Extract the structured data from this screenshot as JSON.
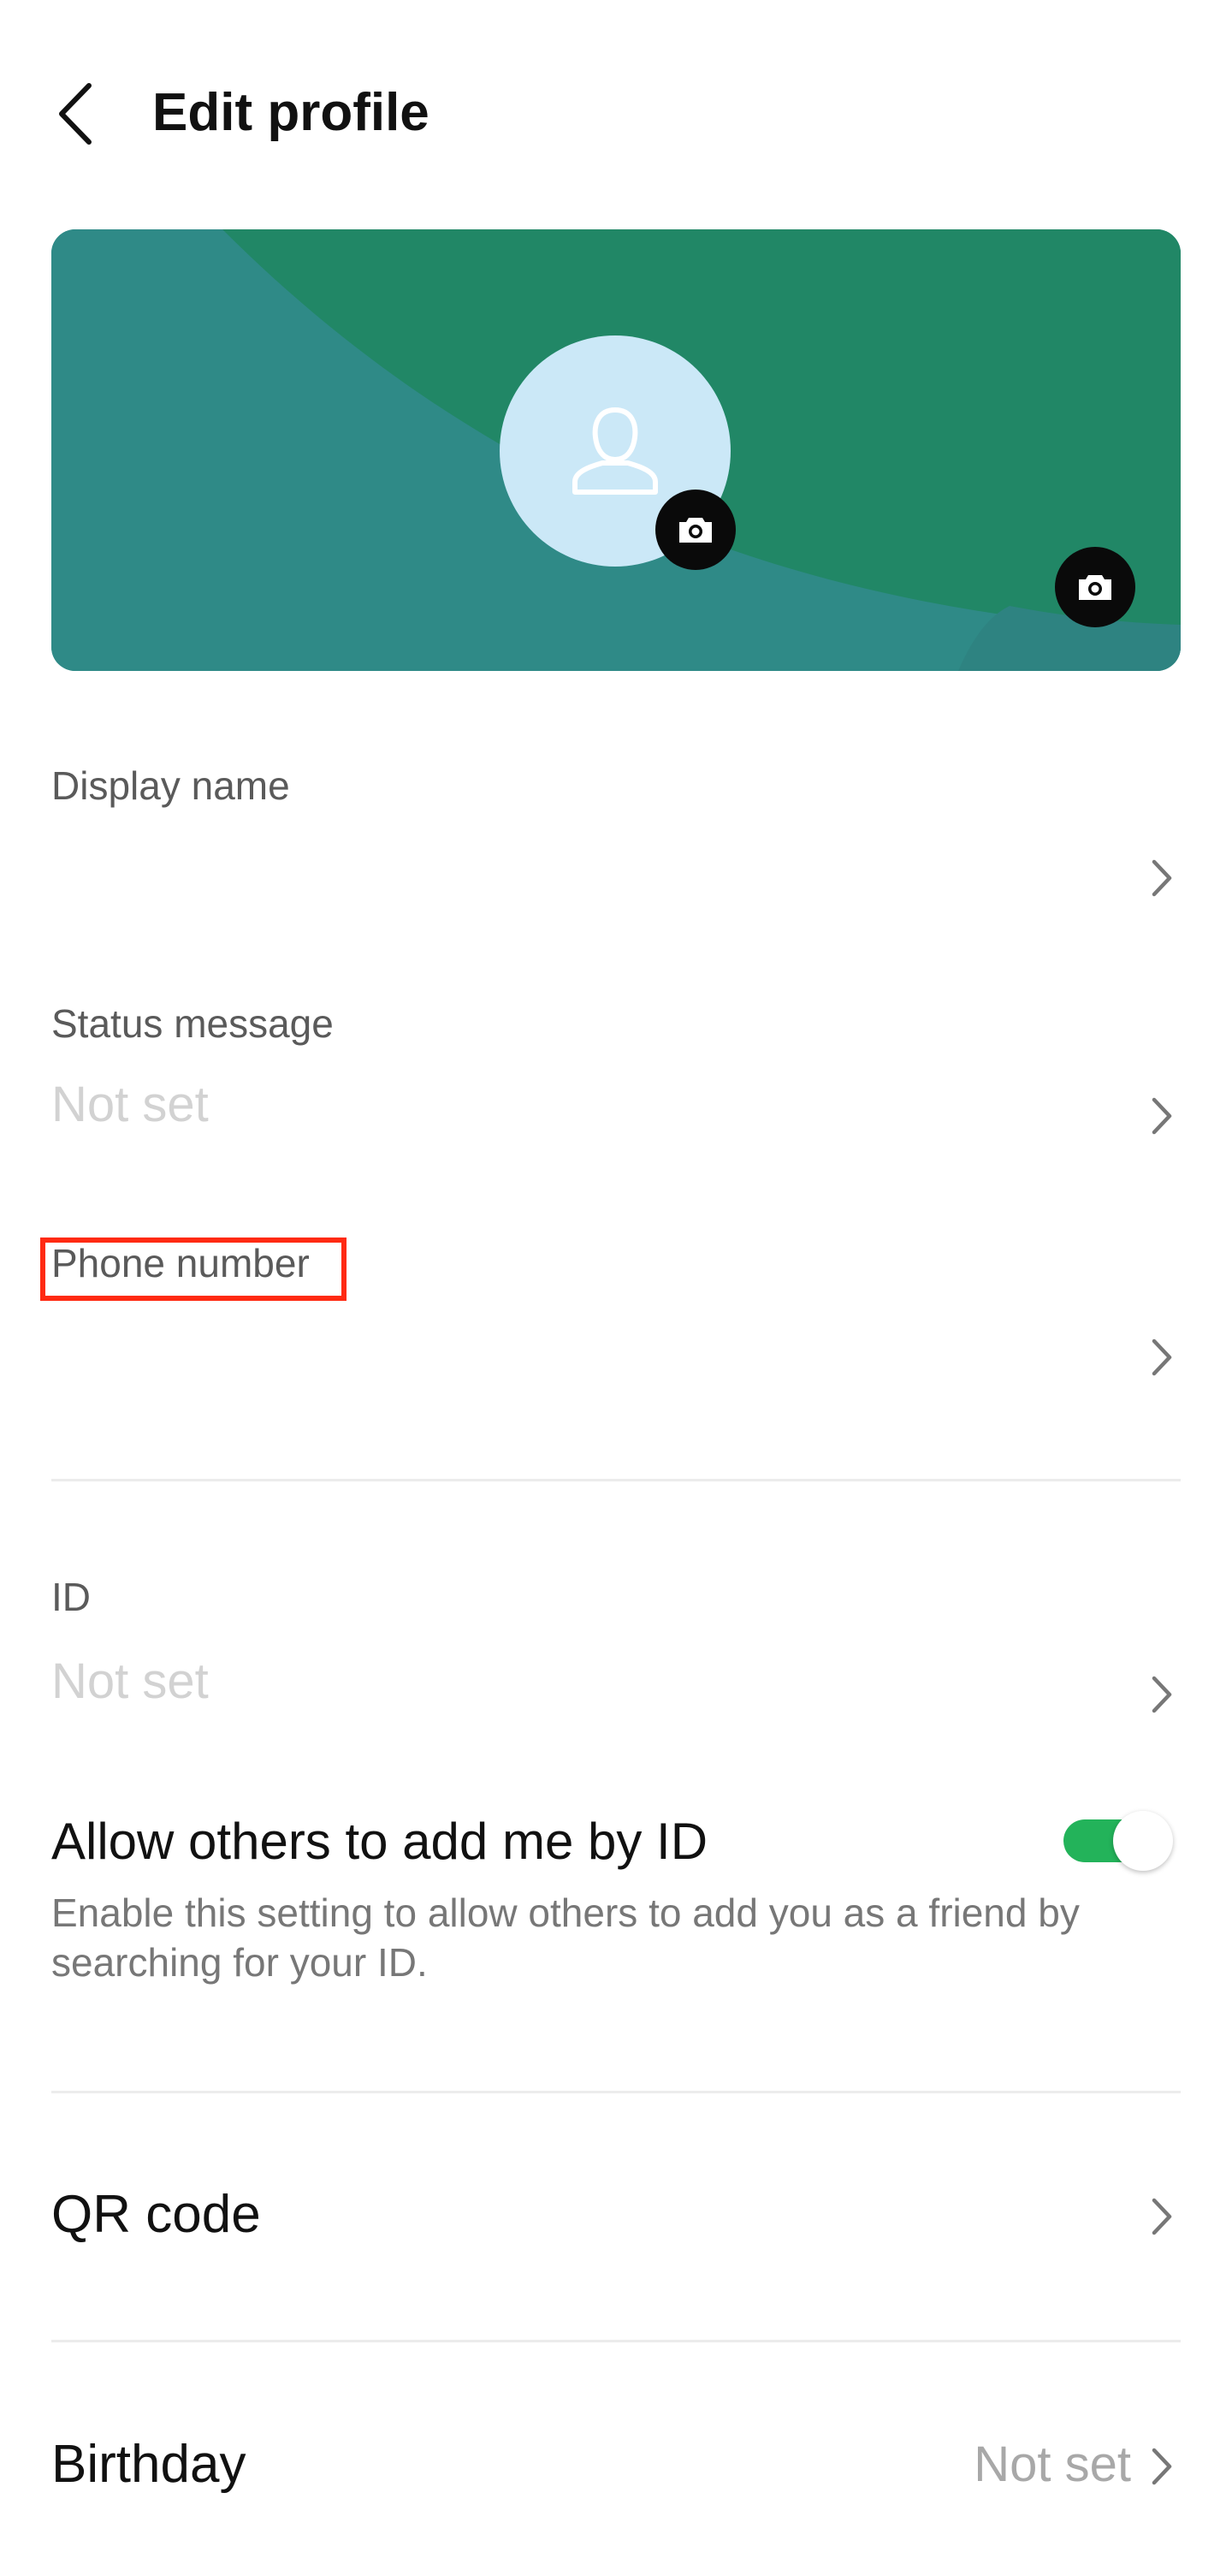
{
  "header": {
    "title": "Edit profile",
    "back_icon": "chevron-left-icon"
  },
  "banner": {
    "colors": {
      "base": "#2f8a87",
      "overlay": "#218766",
      "avatar_bg": "#cbe8f7"
    },
    "avatar_icon": "person-icon",
    "camera_icon": "camera-icon"
  },
  "fields": {
    "display_name": {
      "label": "Display name",
      "value": ""
    },
    "status_message": {
      "label": "Status message",
      "value": "Not set"
    },
    "phone_number": {
      "label": "Phone number",
      "value": ""
    },
    "id": {
      "label": "ID",
      "value": "Not set"
    }
  },
  "allow_by_id": {
    "title": "Allow others to add me by ID",
    "description": "Enable this setting to allow others to add you as a friend by searching for your ID.",
    "enabled": true,
    "accent": "#23b35a"
  },
  "qr_code": {
    "label": "QR code"
  },
  "birthday": {
    "label": "Birthday",
    "value": "Not set"
  }
}
